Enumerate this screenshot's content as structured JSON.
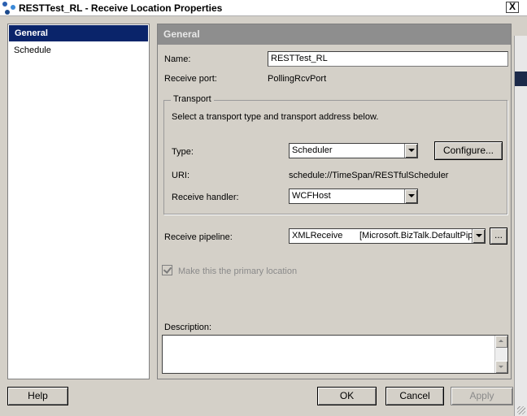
{
  "window": {
    "title": "RESTTest_RL - Receive Location Properties",
    "close_label": "X"
  },
  "sidebar": {
    "items": [
      {
        "label": "General",
        "selected": true
      },
      {
        "label": "Schedule",
        "selected": false
      }
    ]
  },
  "general": {
    "header": "General",
    "name_label": "Name:",
    "name_value": "RESTTest_RL",
    "receive_port_label": "Receive port:",
    "receive_port_value": "PollingRcvPort",
    "transport": {
      "title": "Transport",
      "instruction": "Select a transport type and transport address below.",
      "type_label": "Type:",
      "type_value": "Scheduler",
      "configure_label": "Configure...",
      "uri_label": "URI:",
      "uri_value": "schedule://TimeSpan/RESTfulScheduler",
      "handler_label": "Receive handler:",
      "handler_value": "WCFHost"
    },
    "pipeline_label": "Receive pipeline:",
    "pipeline_name": "XMLReceive",
    "pipeline_assembly": "[Microsoft.BizTalk.DefaultPip",
    "pipeline_browse_label": "...",
    "primary_location_label": "Make this the primary location",
    "description_label": "Description:"
  },
  "buttons": {
    "help": "Help",
    "ok": "OK",
    "cancel": "Cancel",
    "apply": "Apply"
  }
}
